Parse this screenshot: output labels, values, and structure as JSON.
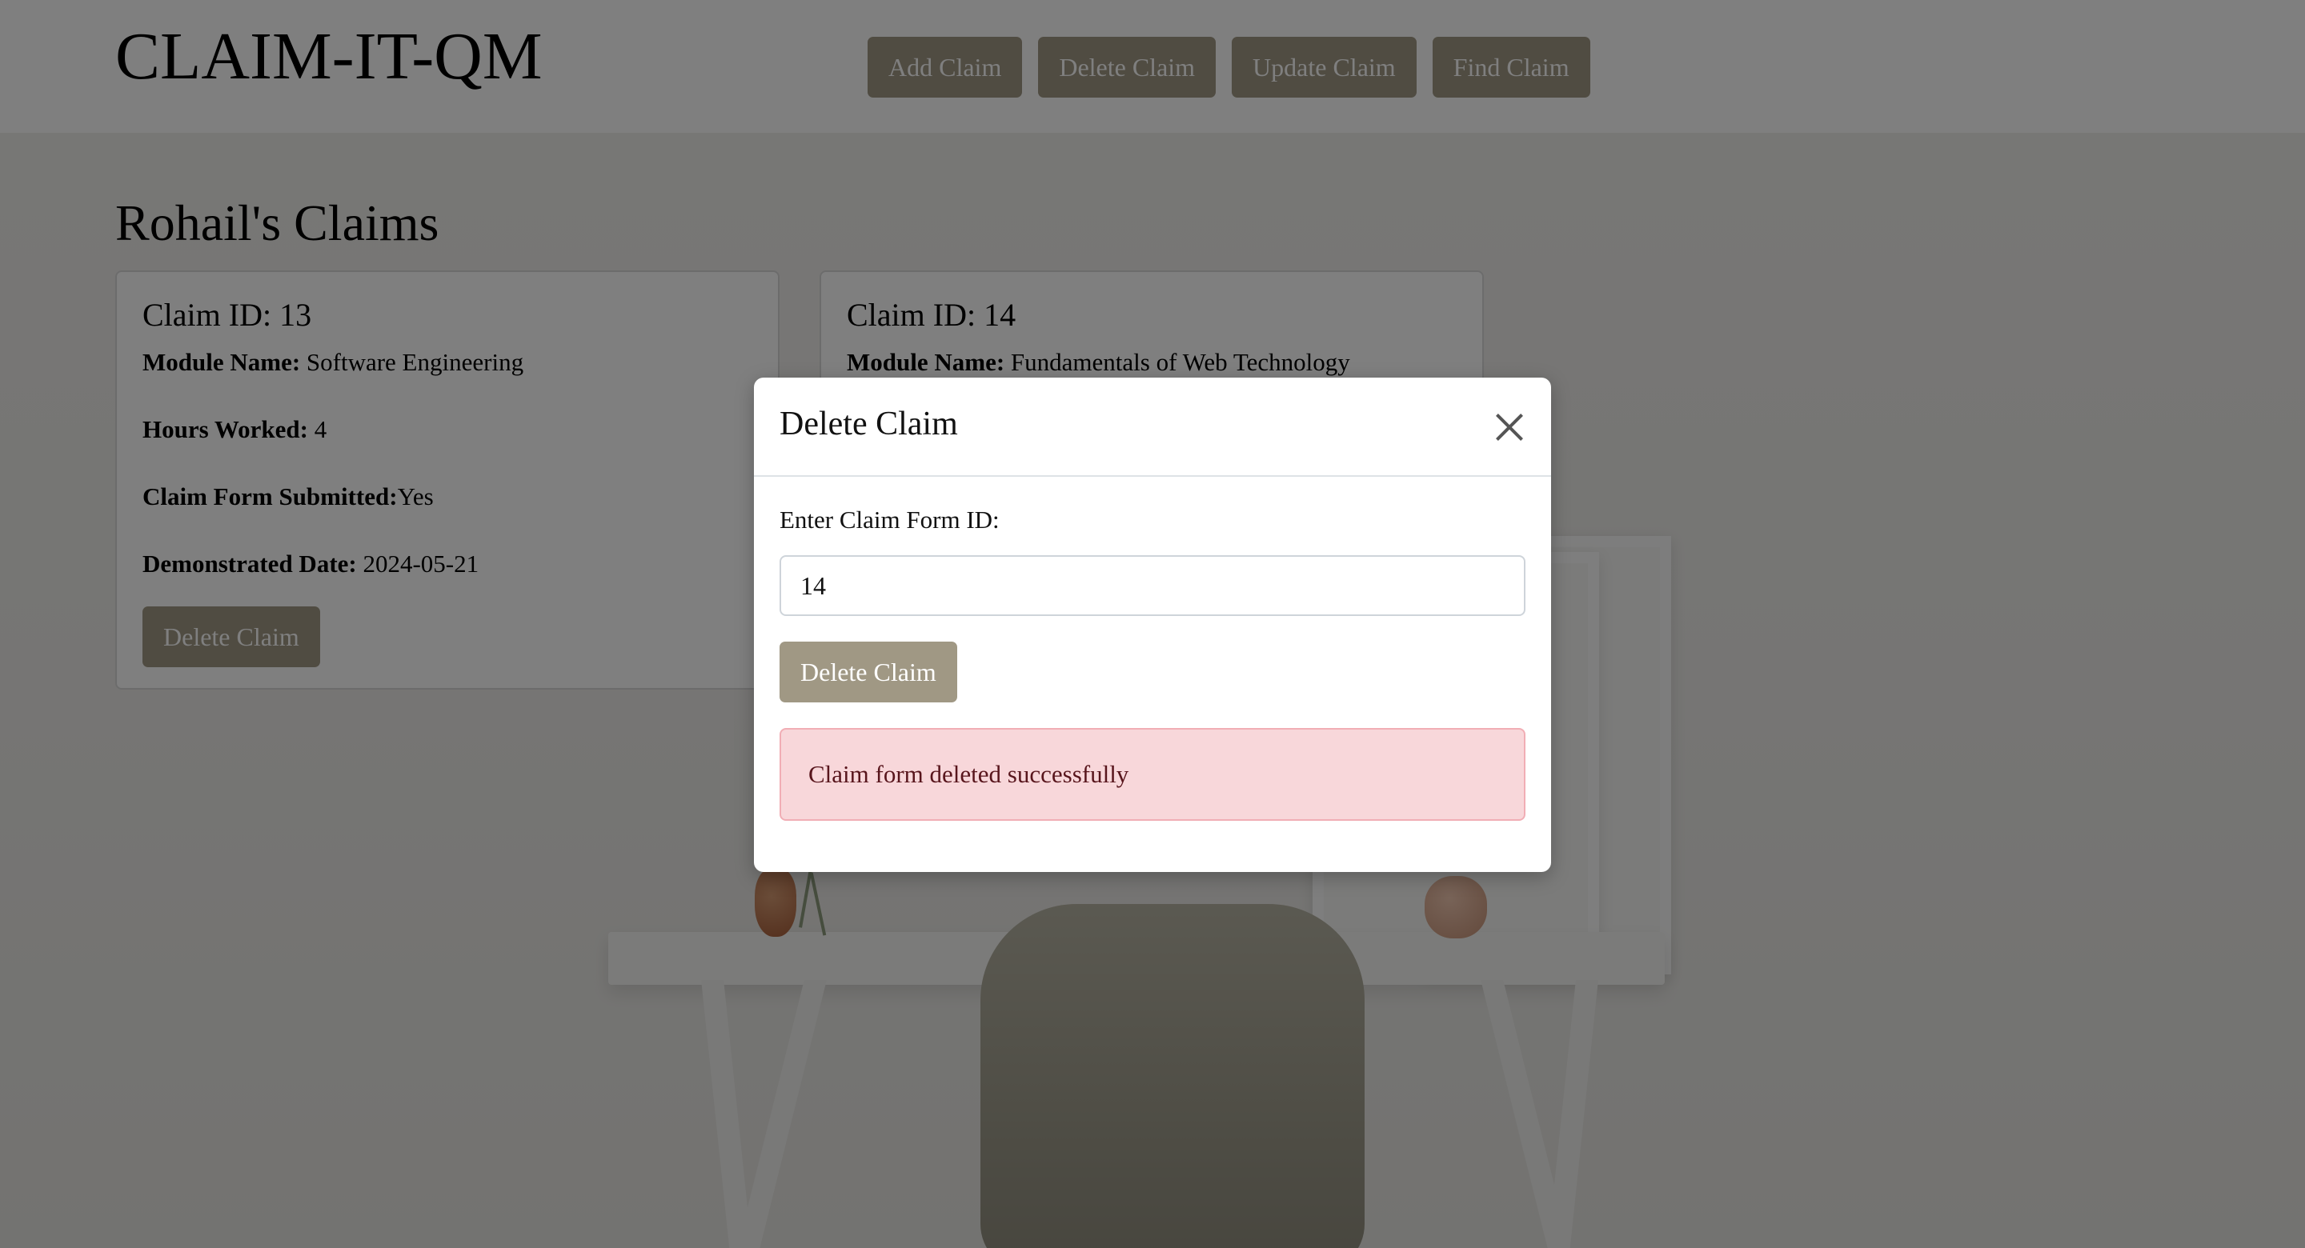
{
  "app": {
    "brand": "CLAIM-IT-QM"
  },
  "nav": {
    "buttons": [
      {
        "label": "Add Claim"
      },
      {
        "label": "Delete Claim"
      },
      {
        "label": "Update Claim"
      },
      {
        "label": "Find Claim"
      }
    ]
  },
  "page": {
    "title": "Rohail's Claims"
  },
  "cards": [
    {
      "title": "Claim ID: 13",
      "module_label": "Module Name:",
      "module_value": "Software Engineering",
      "hours_label": "Hours Worked:",
      "hours_value": "4",
      "submitted_label": "Claim Form Submitted:",
      "submitted_value": "Yes",
      "date_label": "Demonstrated Date:",
      "date_value": "2024-05-21",
      "button_label": "Delete Claim"
    },
    {
      "title": "Claim ID: 14",
      "module_label": "Module Name:",
      "module_value": "Fundamentals of Web Technology"
    }
  ],
  "modal": {
    "title": "Delete Claim",
    "field_label": "Enter Claim Form ID:",
    "input_value": "14",
    "submit_label": "Delete Claim",
    "alert_text": "Claim form deleted successfully"
  },
  "colors": {
    "button": "#a09884",
    "alert_bg": "#f8d7da",
    "alert_border": "#f1aeb5",
    "overlay": "rgba(0,0,0,0.5)"
  }
}
